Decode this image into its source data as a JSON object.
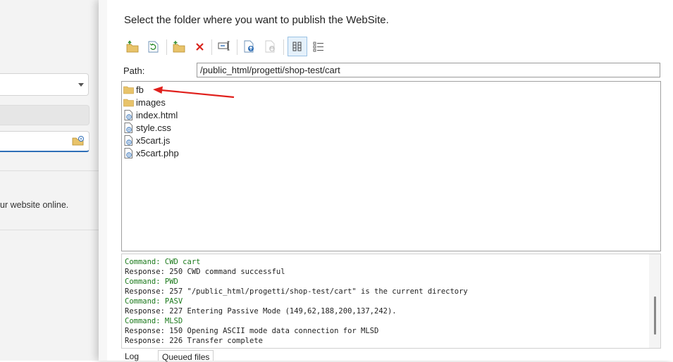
{
  "background_window": {
    "description_text": "ur website online."
  },
  "dialog": {
    "instruction": "Select the folder where you want to publish the WebSite.",
    "path_label": "Path:",
    "path_value": "/public_html/progetti/shop-test/cart",
    "toolbar": [
      {
        "icon": "folder-up-icon"
      },
      {
        "icon": "refresh-icon"
      },
      {
        "icon": "new-folder-icon"
      },
      {
        "icon": "delete-icon"
      },
      {
        "icon": "rename-icon"
      },
      {
        "icon": "upload-file-icon"
      },
      {
        "icon": "download-file-icon"
      },
      {
        "icon": "details-view-icon"
      },
      {
        "icon": "list-view-icon"
      }
    ],
    "files": [
      {
        "name": "fb",
        "type": "folder"
      },
      {
        "name": "images",
        "type": "folder"
      },
      {
        "name": "index.html",
        "type": "file"
      },
      {
        "name": "style.css",
        "type": "file"
      },
      {
        "name": "x5cart.js",
        "type": "file"
      },
      {
        "name": "x5cart.php",
        "type": "file"
      }
    ],
    "log": [
      {
        "kind": "command",
        "text": "Command: CWD cart"
      },
      {
        "kind": "response",
        "text": "Response: 250 CWD command successful"
      },
      {
        "kind": "command",
        "text": "Command: PWD"
      },
      {
        "kind": "response",
        "text": "Response: 257 \"/public_html/progetti/shop-test/cart\" is the current directory"
      },
      {
        "kind": "command",
        "text": "Command: PASV"
      },
      {
        "kind": "response",
        "text": "Response: 227 Entering Passive Mode (149,62,188,200,137,242)."
      },
      {
        "kind": "command",
        "text": "Command: MLSD"
      },
      {
        "kind": "response",
        "text": "Response: 150 Opening ASCII mode data connection for MLSD"
      },
      {
        "kind": "response",
        "text": "Response: 226 Transfer complete"
      }
    ],
    "tabs": {
      "log": "Log",
      "queued": "Queued files"
    }
  },
  "colors": {
    "command_text": "#1c7a1c",
    "annotation_arrow": "#e0201c",
    "folder": "#e8c36a",
    "active_view_bg": "#e5f1fb"
  }
}
